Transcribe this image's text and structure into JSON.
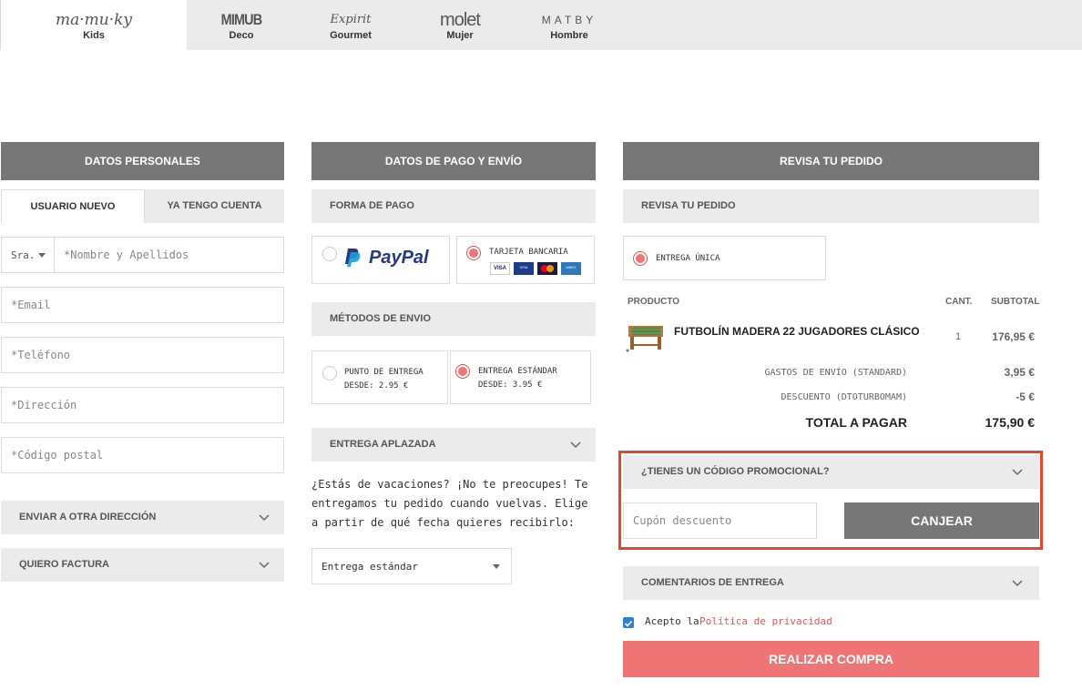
{
  "brands": [
    {
      "logo": "ma·mu·ky",
      "label": "Kids",
      "active": true
    },
    {
      "logo": "MIMUB",
      "label": "Deco",
      "active": false
    },
    {
      "logo": "Expirit",
      "label": "Gourmet",
      "active": false
    },
    {
      "logo": "molet",
      "label": "Mujer",
      "active": false
    },
    {
      "logo": "MATBY",
      "label": "Hombre",
      "active": false
    }
  ],
  "personal": {
    "header": "DATOS PERSONALES",
    "tabs": [
      "USUARIO NUEVO",
      "YA TENGO CUENTA"
    ],
    "title_select": "Sra.",
    "name_placeholder": "*Nombre y Apellidos",
    "email_placeholder": "*Email",
    "phone_placeholder": "*Teléfono",
    "address_placeholder": "*Dirección",
    "zip_placeholder": "*Código postal",
    "other_address": "ENVIAR A OTRA DIRECCIÓN",
    "invoice": "QUIERO FACTURA"
  },
  "payment": {
    "header": "DATOS DE PAGO Y ENVÍO",
    "method_title": "FORMA DE PAGO",
    "paypal_label": "PayPal",
    "card_label": "TARJETA BANCARIA",
    "card_icons": [
      "VISA",
      "VISA Electron",
      "MasterCard",
      "AMEX"
    ],
    "shipping_title": "MÉTODOS DE ENVIO",
    "pickup_label": "PUNTO DE ENTREGA",
    "pickup_price": "DESDE: 2.95 €",
    "standard_label": "ENTREGA ESTÁNDAR",
    "standard_price": "DESDE: 3.95 €",
    "deferred_title": "ENTREGA APLAZADA",
    "deferred_text": "¿Estás de vacaciones? ¡No te preocupes! Te entregamos tu pedido cuando vuelvas. Elige a partir de qué fecha quieres recibirlo:",
    "delivery_select": "Entrega estándar"
  },
  "order": {
    "header": "REVISA TU PEDIDO",
    "section_title": "REVISA TU PEDIDO",
    "delivery_option": "ENTREGA ÚNICA",
    "col_product": "PRODUCTO",
    "col_qty": "CANT.",
    "col_subtotal": "SUBTOTAL",
    "product_name": "FUTBOLÍN MADERA 22 JUGADORES CLÁSICO",
    "product_qty": "1",
    "product_subtotal": "176,95 €",
    "shipping_label": "GASTOS DE ENVÍO (STANDARD)",
    "shipping_value": "3,95 €",
    "discount_label": "DESCUENTO (DTOTURBOMAM)",
    "discount_value": "-5 €",
    "total_label": "TOTAL A PAGAR",
    "total_value": "175,90 €",
    "promo_title": "¿TIENES UN CÓDIGO PROMOCIONAL?",
    "coupon_placeholder": "Cupón descuento",
    "redeem_label": "CANJEAR",
    "comments_title": "COMENTARIOS DE ENTREGA",
    "accept_prefix": "Acepto la",
    "privacy_link": "Política de privacidad",
    "submit_label": "REALIZAR COMPRA"
  },
  "colors": {
    "header_grey": "#777777",
    "light_grey": "#ebebeb",
    "accent_pink": "#ef7474",
    "highlight_red": "#e8452a",
    "paypal_dark": "#253b80",
    "paypal_light": "#179bd7"
  }
}
